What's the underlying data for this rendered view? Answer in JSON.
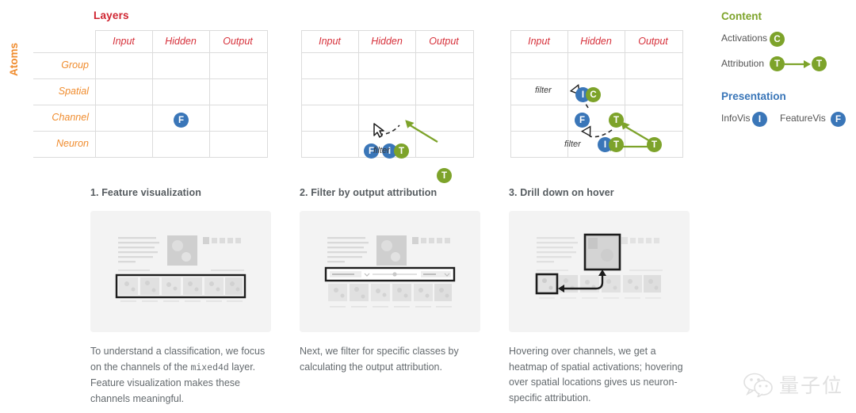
{
  "headings": {
    "layers": "Layers",
    "atoms": "Atoms"
  },
  "matrix": {
    "columns": [
      "Input",
      "Hidden",
      "Output"
    ],
    "rows": [
      "Group",
      "Spatial",
      "Channel",
      "Neuron"
    ]
  },
  "panels": [
    {
      "id": "panel-1",
      "badges": [
        {
          "letter": "F",
          "kind": "presentation",
          "row": "Channel",
          "col": "Hidden"
        }
      ],
      "filter_labels": []
    },
    {
      "id": "panel-2",
      "badges": [
        {
          "letter": "F",
          "kind": "presentation",
          "row": "Channel",
          "col": "Hidden"
        },
        {
          "letter": "I",
          "kind": "presentation",
          "row": "Channel",
          "col": "Hidden"
        },
        {
          "letter": "T",
          "kind": "content",
          "row": "Channel",
          "col": "Hidden"
        },
        {
          "letter": "T",
          "kind": "content",
          "row": "Neuron",
          "col": "Output"
        }
      ],
      "filter_labels": [
        "filter"
      ]
    },
    {
      "id": "panel-3",
      "badges": [
        {
          "letter": "I",
          "kind": "presentation",
          "row": "Spatial",
          "col": "Hidden"
        },
        {
          "letter": "C",
          "kind": "content",
          "row": "Spatial",
          "col": "Hidden"
        },
        {
          "letter": "F",
          "kind": "presentation",
          "row": "Channel",
          "col": "Hidden"
        },
        {
          "letter": "T",
          "kind": "content",
          "row": "Channel",
          "col": "Hidden"
        },
        {
          "letter": "I",
          "kind": "presentation",
          "row": "Neuron",
          "col": "Hidden"
        },
        {
          "letter": "T",
          "kind": "content",
          "row": "Neuron",
          "col": "Hidden"
        },
        {
          "letter": "T",
          "kind": "content",
          "row": "Neuron",
          "col": "Output"
        }
      ],
      "filter_labels": [
        "filter",
        "filter"
      ]
    }
  ],
  "legend": {
    "content": {
      "title": "Content",
      "color": "#7da32a",
      "items": [
        {
          "label": "Activations",
          "badges": [
            "C"
          ]
        },
        {
          "label": "Attribution",
          "badges": [
            "T",
            "T"
          ]
        }
      ]
    },
    "presentation": {
      "title": "Presentation",
      "color": "#3a76b8",
      "items": [
        {
          "label": "InfoVis",
          "badges": [
            "I"
          ]
        },
        {
          "label": "FeatureVis",
          "badges": [
            "F"
          ]
        }
      ]
    }
  },
  "steps": [
    {
      "title": "1. Feature visualization",
      "caption_pre": "To understand a classification, we focus on the channels of the ",
      "caption_code": "mixed4d",
      "caption_post": " layer. Feature visualization makes these channels meaningful."
    },
    {
      "title": "2. Filter by output attribution",
      "caption_pre": "Next, we filter for specific classes by calculating the output attribution.",
      "caption_code": "",
      "caption_post": ""
    },
    {
      "title": "3. Drill down on hover",
      "caption_pre": "Hovering over channels, we get a heatmap of spatial activations; hovering over spatial locations gives us neuron-specific attribution.",
      "caption_code": "",
      "caption_post": ""
    }
  ],
  "watermark": {
    "text": "量子位",
    "icon": "wechat-icon"
  },
  "colors": {
    "layers_red": "#cf2430",
    "atoms_orange": "#f08c2e",
    "content_green": "#7da32a",
    "presentation_blue": "#3a76b8",
    "grid": "#dcdcdc",
    "caption_text": "#646a6e"
  }
}
